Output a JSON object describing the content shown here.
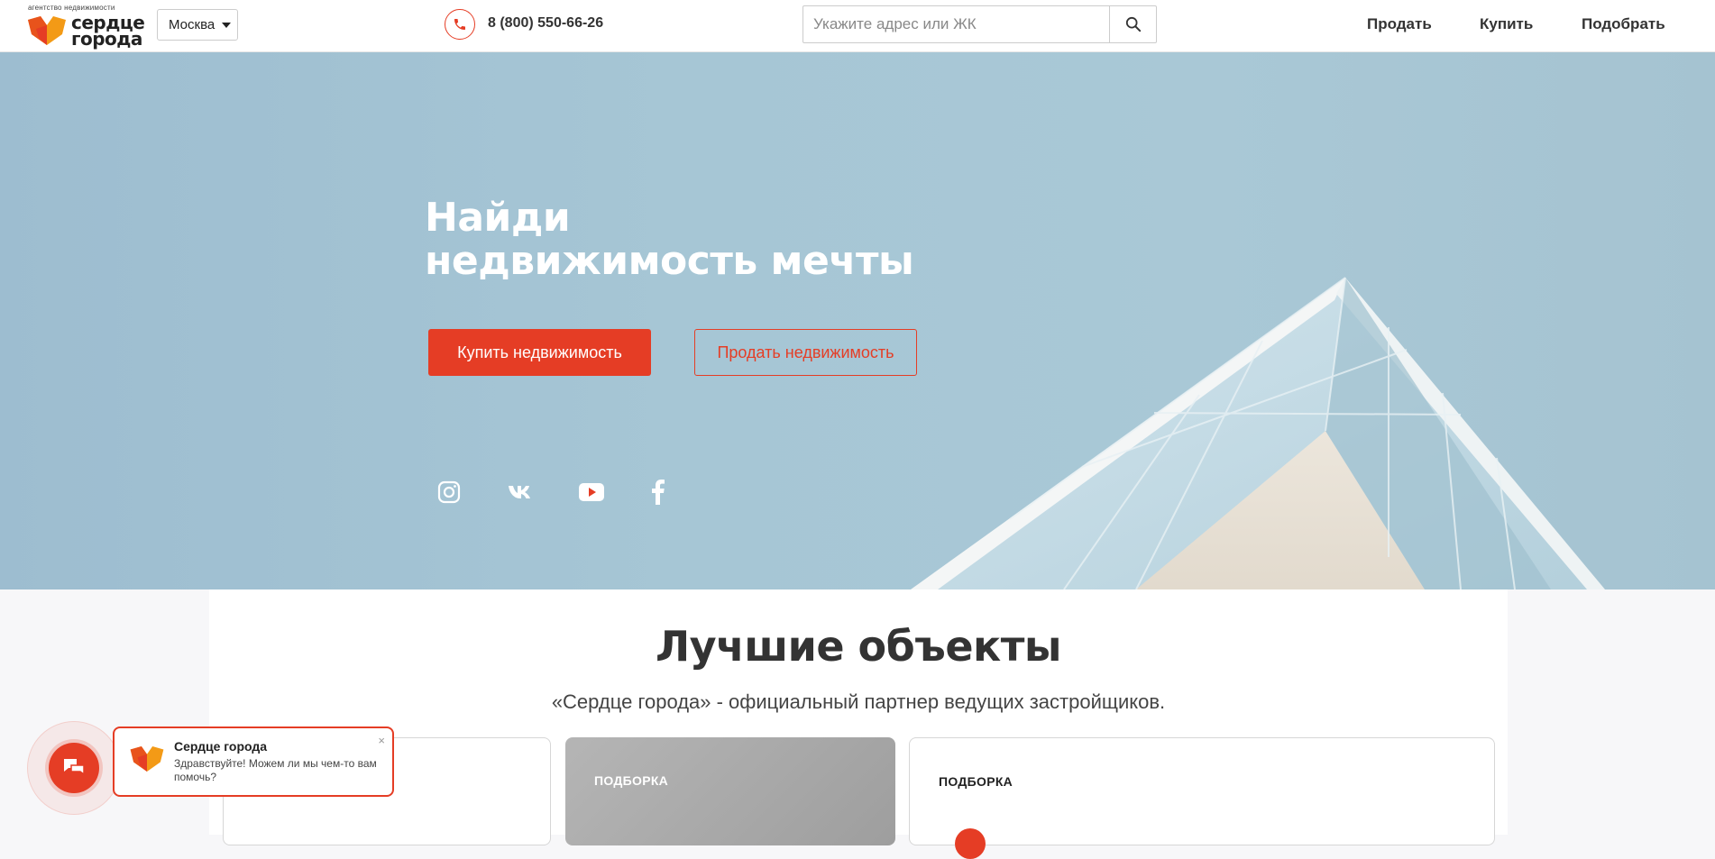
{
  "header": {
    "logo_sub": "агентство недвижимости",
    "logo_line1": "сердце",
    "logo_line2": "города",
    "city": "Москва",
    "phone": "8 (800) 550-66-26",
    "search_placeholder": "Укажите адрес или ЖК",
    "nav": [
      "Продать",
      "Купить",
      "Подобрать"
    ]
  },
  "hero": {
    "title_line1": "Найди",
    "title_line2": "недвижимость мечты",
    "buy_label": "Купить недвижимость",
    "sell_label": "Продать недвижимость",
    "social": [
      "instagram-icon",
      "vk-icon",
      "youtube-icon",
      "facebook-icon"
    ]
  },
  "section": {
    "title": "Лучшие объекты",
    "subtitle": "«Сердце города» - официальный партнер ведущих застройщиков.",
    "cards": [
      {
        "label": ""
      },
      {
        "label": "ПОДБОРКА"
      },
      {
        "label": "ПОДБОРКА"
      }
    ]
  },
  "chat": {
    "name": "Сердце города",
    "message": "Здравствуйте! Можем ли мы чем-то вам помочь?",
    "close": "×"
  },
  "colors": {
    "accent": "#e53d25",
    "hero_bg": "#a6c6d5"
  }
}
